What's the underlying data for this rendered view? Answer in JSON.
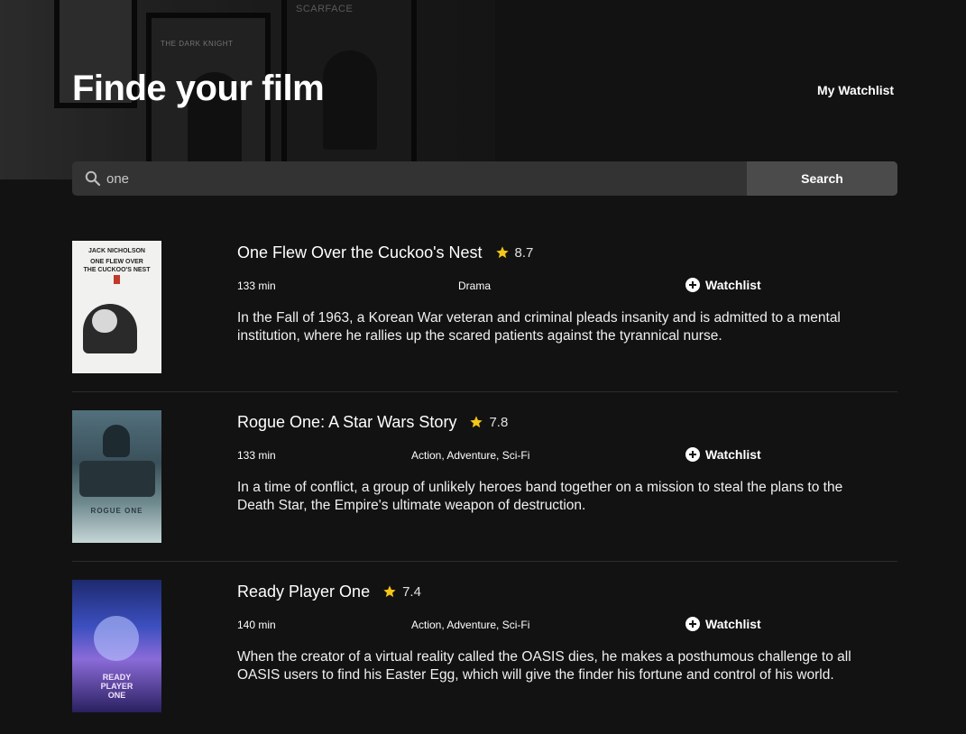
{
  "header": {
    "title": "Finde your film",
    "watchlist_link": "My Watchlist"
  },
  "search": {
    "value": "one",
    "placeholder": "",
    "button_label": "Search"
  },
  "movies": [
    {
      "title": "One Flew Over the Cuckoo's Nest",
      "rating": "8.7",
      "runtime": "133 min",
      "genre": "Drama",
      "watchlist_label": "Watchlist",
      "plot": "In the Fall of 1963, a Korean War veteran and criminal pleads insanity and is admitted to a mental institution, where he rallies up the scared patients against the tyrannical nurse.",
      "poster_text": [
        "JACK NICHOLSON",
        "ONE FLEW OVER",
        "THE CUCKOO'S NEST"
      ]
    },
    {
      "title": "Rogue One: A Star Wars Story",
      "rating": "7.8",
      "runtime": "133 min",
      "genre": "Action, Adventure, Sci-Fi",
      "watchlist_label": "Watchlist",
      "plot": "In a time of conflict, a group of unlikely heroes band together on a mission to steal the plans to the Death Star, the Empire's ultimate weapon of destruction.",
      "poster_text": [
        "ROGUE ONE"
      ]
    },
    {
      "title": "Ready Player One",
      "rating": "7.4",
      "runtime": "140 min",
      "genre": "Action, Adventure, Sci-Fi",
      "watchlist_label": "Watchlist",
      "plot": "When the creator of a virtual reality called the OASIS dies, he makes a posthumous challenge to all OASIS users to find his Easter Egg, which will give the finder his fortune and control of his world.",
      "poster_text": [
        "READY",
        "PLAYER",
        "ONE"
      ]
    }
  ],
  "hero": {
    "frame_labels": [
      "THE DARK KNIGHT",
      "SCARFACE"
    ]
  },
  "colors": {
    "background": "#121212",
    "search_bar": "#333333",
    "search_button": "#4b4b4b",
    "star": "#f5c518",
    "divider": "#2c2c2c"
  },
  "icons": [
    "search-icon",
    "star-icon",
    "plus-circle-icon"
  ]
}
